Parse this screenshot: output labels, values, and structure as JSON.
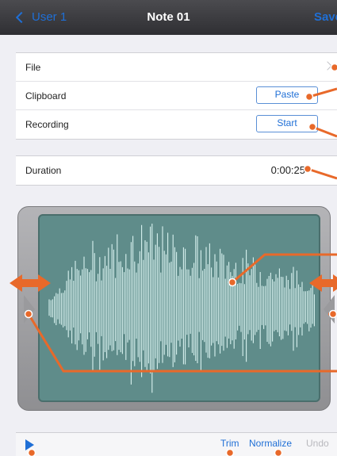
{
  "navbar": {
    "back_label": "User 1",
    "title": "Note 01",
    "save_label": "Save"
  },
  "settings": {
    "file_label": "File",
    "clipboard_label": "Clipboard",
    "paste_label": "Paste",
    "recording_label": "Recording",
    "start_label": "Start"
  },
  "duration": {
    "label": "Duration",
    "value": "0:00:25"
  },
  "toolbar": {
    "trim_label": "Trim",
    "normalize_label": "Normalize",
    "undo_label": "Undo"
  },
  "colors": {
    "accent": "#1f6fd6",
    "callout": "#e8692a",
    "waveform_bg": "#5f8c8a",
    "waveform_line": "#d8f2ef"
  },
  "icons": {
    "back": "chevron-left-icon",
    "disclosure": "chevron-right-icon",
    "play": "play-icon",
    "trim_left": "left-trim-handle-icon",
    "trim_right": "right-trim-handle-icon"
  }
}
